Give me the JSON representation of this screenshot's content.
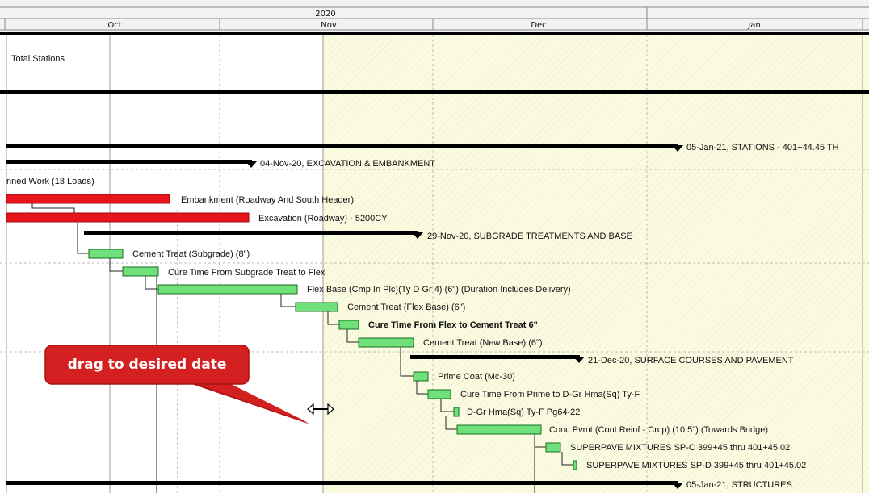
{
  "timescale": {
    "year": "2020",
    "months": [
      "Oct",
      "Nov",
      "Dec",
      "Jan"
    ]
  },
  "rows": [
    {
      "kind": "text",
      "label": "Total Stations"
    },
    {
      "kind": "summary",
      "label": "05-Jan-21, STATIONS - 401+44.45 TH"
    },
    {
      "kind": "summary",
      "label": "04-Nov-20, EXCAVATION & EMBANKMENT"
    },
    {
      "kind": "text",
      "label": "nned Work (18 Loads)"
    },
    {
      "kind": "critical",
      "label": "Embankment (Roadway And South Header)"
    },
    {
      "kind": "critical",
      "label": "Excavation (Roadway) - 5200CY"
    },
    {
      "kind": "summary",
      "label": "29-Nov-20, SUBGRADE TREATMENTS AND BASE"
    },
    {
      "kind": "task",
      "label": "Cement Treat (Subgrade) (8\")"
    },
    {
      "kind": "task",
      "label": "Cure Time From Subgrade Treat to Flex"
    },
    {
      "kind": "task",
      "label": "Flex Base (Cmp In Plc)(Ty D Gr 4) (6\") (Duration Includes Delivery)"
    },
    {
      "kind": "task",
      "label": "Cement Treat (Flex Base) (6\")"
    },
    {
      "kind": "task",
      "label": "Cure Time From Flex to Cement Treat 6\""
    },
    {
      "kind": "task",
      "label": "Cement Treat (New Base) (6\")"
    },
    {
      "kind": "summary",
      "label": "21-Dec-20, SURFACE COURSES AND PAVEMENT"
    },
    {
      "kind": "task",
      "label": "Prime Coat (Mc-30)"
    },
    {
      "kind": "task",
      "label": "Cure Time From Prime to D-Gr Hma(Sq) Ty-F"
    },
    {
      "kind": "task",
      "label": "D-Gr Hma(Sq) Ty-F Pg64-22"
    },
    {
      "kind": "task",
      "label": "Conc Pvmt (Cont Reinf - Crcp) (10.5\") (Towards Bridge)"
    },
    {
      "kind": "task",
      "label": "SUPERPAVE MIXTURES SP-C 399+45 thru 401+45.02"
    },
    {
      "kind": "task",
      "label": "SUPERPAVE MIXTURES SP-D 399+45 thru 401+45.02"
    },
    {
      "kind": "summary",
      "label": "05-Jan-21, STRUCTURES"
    }
  ],
  "callout": {
    "text": "drag to desired date"
  },
  "colors": {
    "critical": "#e8141b",
    "task": "#6fe07a",
    "summary": "#000000",
    "shade": "#fbfbe2",
    "callout": "#d42020"
  },
  "cursor": "resize-horizontal-icon"
}
